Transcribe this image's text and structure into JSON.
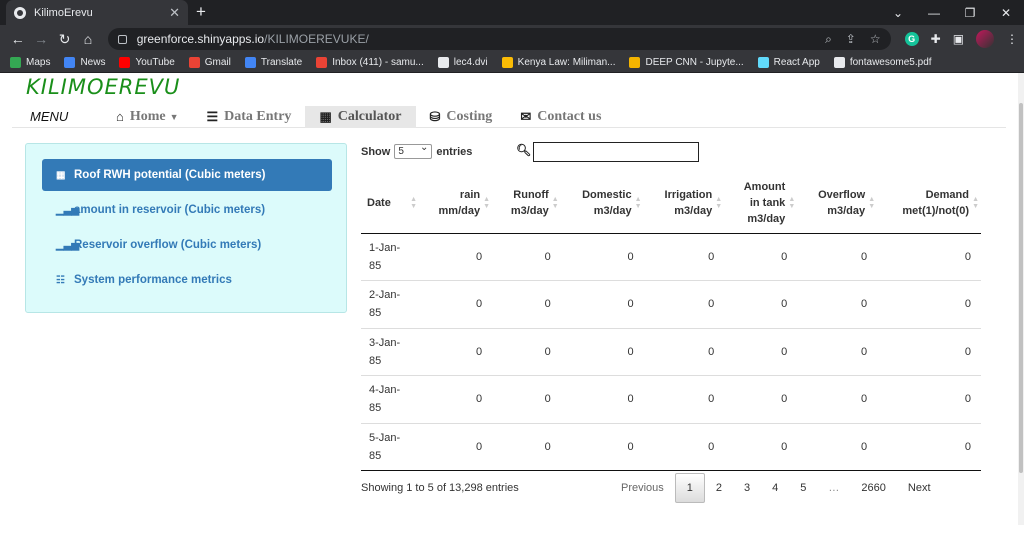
{
  "browser": {
    "tab_title": "KilimoErevu",
    "url_host": "greenforce.shinyapps.io",
    "url_path": "/KILIMOEREVUKE/",
    "bookmarks": [
      "Maps",
      "News",
      "YouTube",
      "Gmail",
      "Translate",
      "Inbox (411) - samu...",
      "lec4.dvi",
      "Kenya Law: Miliman...",
      "DEEP CNN - Jupyte...",
      "React App",
      "fontawesome5.pdf"
    ],
    "bookmark_colors": [
      "#34a853",
      "#4285f4",
      "#ff0000",
      "#ea4335",
      "#4285f4",
      "#ea4335",
      "#e8eaed",
      "#fbbc05",
      "#f4b400",
      "#61dafb",
      "#e8eaed"
    ]
  },
  "app": {
    "brand": "KILIMOEREVU",
    "menu_label": "MENU",
    "nav": [
      {
        "label": "Home",
        "icon": "home-icon"
      },
      {
        "label": "Data Entry",
        "icon": "database-icon"
      },
      {
        "label": "Calculator",
        "icon": "calculator-icon"
      },
      {
        "label": "Costing",
        "icon": "coins-icon"
      },
      {
        "label": "Contact us",
        "icon": "envelope-icon"
      }
    ],
    "active_nav": "Calculator"
  },
  "sidebar": {
    "items": [
      {
        "label": "Roof RWH potential (Cubic meters)",
        "icon": "table-icon"
      },
      {
        "label": "amount in reservoir (Cubic meters)",
        "icon": "bar-chart-icon"
      },
      {
        "label": "Reservoir overflow (Cubic meters)",
        "icon": "bar-chart-icon"
      },
      {
        "label": "System performance metrics",
        "icon": "list-icon"
      }
    ]
  },
  "table": {
    "show_label": "Show",
    "entries_label": "entries",
    "page_length": "5",
    "columns": [
      {
        "line1": "Date",
        "line2": "",
        "line3": ""
      },
      {
        "line1": "rain",
        "line2": "mm/day",
        "line3": ""
      },
      {
        "line1": "Runoff",
        "line2": "m3/day",
        "line3": ""
      },
      {
        "line1": "Domestic",
        "line2": "m3/day",
        "line3": ""
      },
      {
        "line1": "Irrigation",
        "line2": "m3/day",
        "line3": ""
      },
      {
        "line1": "Amount",
        "line2": "in tank",
        "line3": "m3/day"
      },
      {
        "line1": "Overflow",
        "line2": "m3/day",
        "line3": ""
      },
      {
        "line1": "Demand",
        "line2": "met(1)/not(0)",
        "line3": ""
      }
    ],
    "rows": [
      {
        "date1": "1-Jan-",
        "date2": "85",
        "values": [
          "0",
          "0",
          "0",
          "0",
          "0",
          "0",
          "0"
        ]
      },
      {
        "date1": "2-Jan-",
        "date2": "85",
        "values": [
          "0",
          "0",
          "0",
          "0",
          "0",
          "0",
          "0"
        ]
      },
      {
        "date1": "3-Jan-",
        "date2": "85",
        "values": [
          "0",
          "0",
          "0",
          "0",
          "0",
          "0",
          "0"
        ]
      },
      {
        "date1": "4-Jan-",
        "date2": "85",
        "values": [
          "0",
          "0",
          "0",
          "0",
          "0",
          "0",
          "0"
        ]
      },
      {
        "date1": "5-Jan-",
        "date2": "85",
        "values": [
          "0",
          "0",
          "0",
          "0",
          "0",
          "0",
          "0"
        ]
      }
    ],
    "info": "Showing 1 to 5 of 13,298 entries",
    "pagination": {
      "previous": "Previous",
      "pages": [
        "1",
        "2",
        "3",
        "4",
        "5"
      ],
      "ellipsis": "…",
      "last": "2660",
      "next": "Next",
      "current": "1"
    }
  }
}
